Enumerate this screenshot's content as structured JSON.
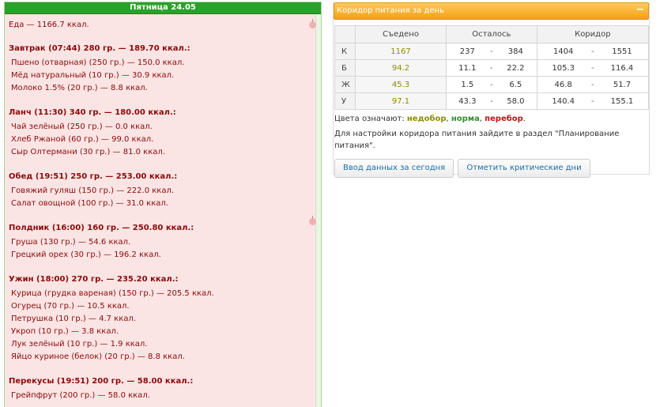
{
  "day": {
    "title": "Пятница 24.05",
    "total": "Еда — 1166.7 ккал.",
    "meals": [
      {
        "title": "Завтрак (07:44) 280 гр. — 189.70 ккал.:",
        "items": [
          "Пшено (отварная) (250 гр.) — 150.0 ккал.",
          "Мёд натуральный (10 гр.) — 30.9 ккал.",
          "Молоко 1.5% (20 гр.) — 8.8 ккал."
        ]
      },
      {
        "title": "Ланч (11:30) 340 гр. — 180.00 ккал.:",
        "items": [
          "Чай зелёный (250 гр.) — 0.0 ккал.",
          "Хлеб Ржаной (60 гр.) — 99.0 ккал.",
          "Сыр Олтермани (30 гр.) — 81.0 ккал."
        ]
      },
      {
        "title": "Обед (19:51) 250 гр. — 253.00 ккал.:",
        "items": [
          "Говяжий гуляш (150 гр.) — 222.0 ккал.",
          "Салат овощной (100 гр.) — 31.0 ккал."
        ]
      },
      {
        "title": "Полдник (16:00) 160 гр. — 250.80 ккал.:",
        "items": [
          "Груша (130 гр.) — 54.6 ккал.",
          "Грецкий орех (30 гр.) — 196.2 ккал."
        ]
      },
      {
        "title": "Ужин (18:00) 270 гр. — 235.20 ккал.:",
        "items": [
          "Курица (грудка вареная) (150 гр.) — 205.5 ккал.",
          "Огурец (70 гр.) — 10.5 ккал.",
          "Петрушка (10 гр.) — 4.7 ккал.",
          "Укроп (10 гр.) — 3.8 ккал.",
          "Лук зелёный (10 гр.) — 1.9 ккал.",
          "Яйцо куриное (белок) (20 гр.) — 8.8 ккал."
        ]
      },
      {
        "title": "Перекусы (19:51) 200 гр. — 58.00 ккал.:",
        "items": [
          "Грейпфрут (200 гр.) — 58.0 ккал."
        ]
      }
    ]
  },
  "corridor": {
    "title": "Коридор питания за день",
    "collapse_symbol": "−",
    "headers": {
      "eaten": "Съедено",
      "remaining": "Осталось",
      "corridor": "Коридор"
    },
    "rows": [
      {
        "label": "К",
        "eaten": "1167",
        "rem_min": "237",
        "rem_sep": "-",
        "rem_max": "384",
        "cor_min": "1404",
        "cor_sep": "-",
        "cor_max": "1551"
      },
      {
        "label": "Б",
        "eaten": "94.2",
        "rem_min": "11.1",
        "rem_sep": "-",
        "rem_max": "22.2",
        "cor_min": "105.3",
        "cor_sep": "-",
        "cor_max": "116.4"
      },
      {
        "label": "Ж",
        "eaten": "45.3",
        "rem_min": "1.5",
        "rem_sep": "-",
        "rem_max": "6.5",
        "cor_min": "46.8",
        "cor_sep": "-",
        "cor_max": "51.7"
      },
      {
        "label": "У",
        "eaten": "97.1",
        "rem_min": "43.3",
        "rem_sep": "-",
        "rem_max": "58.0",
        "cor_min": "140.4",
        "cor_sep": "-",
        "cor_max": "155.1"
      }
    ],
    "legend_prefix": "Цвета означают: ",
    "legend_under": "недобор",
    "legend_comma1": ", ",
    "legend_norm": "норма",
    "legend_comma2": ", ",
    "legend_over": "перебор",
    "legend_end": ".",
    "hint": "Для настройки коридора питания зайдите в раздел \"Планирование питания\".",
    "buttons": {
      "enter_today": "Ввод данных за сегодня",
      "critical_days": "Отметить критические дни"
    }
  },
  "colors": {
    "header_green": "#2aa12a",
    "header_orange": "#f2a116",
    "under": "#8c8c00",
    "norm": "#2f8f2f",
    "over": "#c01313"
  }
}
